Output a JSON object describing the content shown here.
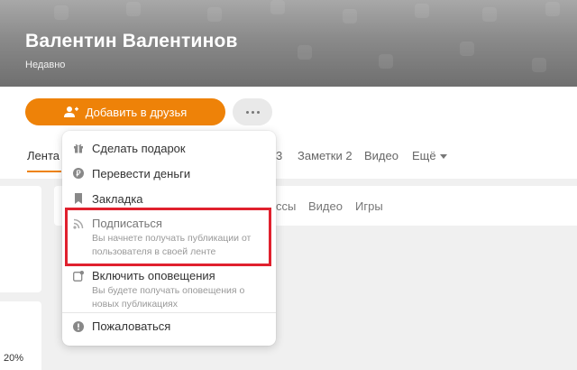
{
  "profile": {
    "name": "Валентин Валентинов",
    "status": "Недавно"
  },
  "actions": {
    "add_friend_label": "Добавить в друзья",
    "more_icon": "ellipsis-icon"
  },
  "tabs": {
    "active": "Лента",
    "partial_count": "3",
    "notes": "Заметки 2",
    "video": "Видео",
    "more": "Ещё"
  },
  "feed_filters": {
    "items": [
      "ссы",
      "Видео",
      "Игры"
    ]
  },
  "left_cards": {
    "percent": "20%"
  },
  "menu": {
    "items": [
      {
        "label": "Сделать подарок",
        "icon": "gift-icon"
      },
      {
        "label": "Перевести деньги",
        "icon": "ruble-coin-icon"
      },
      {
        "label": "Закладка",
        "icon": "bookmark-icon"
      },
      {
        "label": "Подписаться",
        "icon": "rss-icon",
        "description": "Вы начнете получать публикации от пользователя в своей ленте"
      },
      {
        "label": "Включить оповещения",
        "icon": "notification-icon",
        "description": "Вы будете получать оповещения о новых публикациях"
      },
      {
        "label": "Пожаловаться",
        "icon": "alert-icon"
      }
    ]
  },
  "colors": {
    "accent": "#ee8208",
    "highlight": "#e0212e"
  }
}
